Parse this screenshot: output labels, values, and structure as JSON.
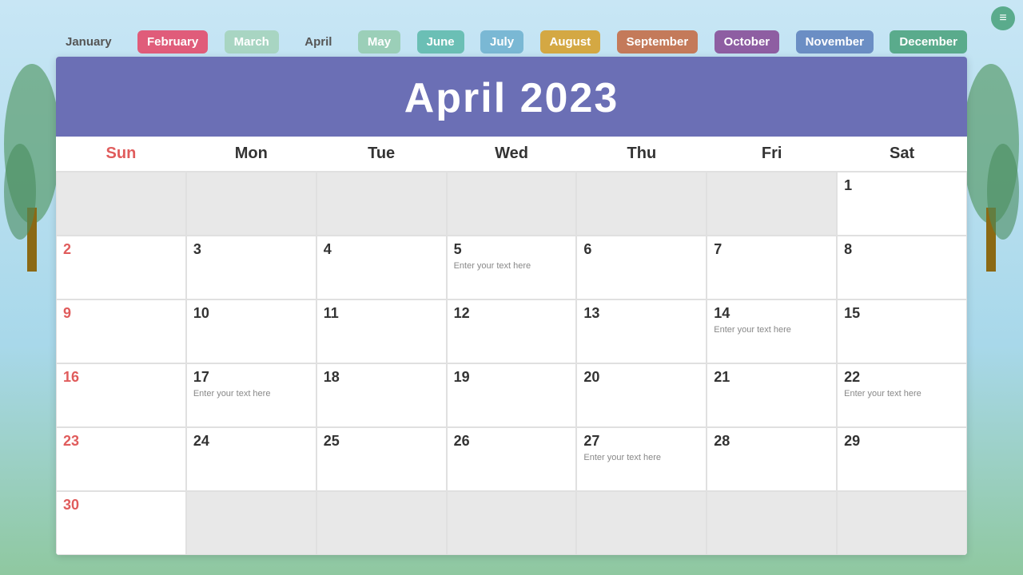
{
  "tabs": [
    {
      "id": "january",
      "label": "January",
      "active": false
    },
    {
      "id": "february",
      "label": "February",
      "active": true
    },
    {
      "id": "march",
      "label": "March",
      "active": false
    },
    {
      "id": "april",
      "label": "April",
      "active": false
    },
    {
      "id": "may",
      "label": "May",
      "active": false
    },
    {
      "id": "june",
      "label": "June",
      "active": false
    },
    {
      "id": "july",
      "label": "July",
      "active": false
    },
    {
      "id": "august",
      "label": "August",
      "active": false
    },
    {
      "id": "september",
      "label": "September",
      "active": false
    },
    {
      "id": "october",
      "label": "October",
      "active": false
    },
    {
      "id": "november",
      "label": "November",
      "active": false
    },
    {
      "id": "december",
      "label": "December",
      "active": false
    }
  ],
  "calendar": {
    "title": "April 2023",
    "dayHeaders": [
      "Sun",
      "Mon",
      "Tue",
      "Wed",
      "Thu",
      "Fri",
      "Sat"
    ],
    "cells": [
      {
        "day": "",
        "empty": true,
        "text": ""
      },
      {
        "day": "",
        "empty": true,
        "text": ""
      },
      {
        "day": "",
        "empty": true,
        "text": ""
      },
      {
        "day": "",
        "empty": true,
        "text": ""
      },
      {
        "day": "",
        "empty": true,
        "text": ""
      },
      {
        "day": "",
        "empty": true,
        "text": ""
      },
      {
        "day": "1",
        "empty": false,
        "text": "",
        "isSunday": false
      },
      {
        "day": "2",
        "empty": false,
        "text": "",
        "isSunday": true
      },
      {
        "day": "3",
        "empty": false,
        "text": "",
        "isSunday": false
      },
      {
        "day": "4",
        "empty": false,
        "text": "",
        "isSunday": false
      },
      {
        "day": "5",
        "empty": false,
        "text": "Enter your text here",
        "isSunday": false
      },
      {
        "day": "6",
        "empty": false,
        "text": "",
        "isSunday": false
      },
      {
        "day": "7",
        "empty": false,
        "text": "",
        "isSunday": false
      },
      {
        "day": "8",
        "empty": false,
        "text": "",
        "isSunday": false
      },
      {
        "day": "9",
        "empty": false,
        "text": "",
        "isSunday": true
      },
      {
        "day": "10",
        "empty": false,
        "text": "",
        "isSunday": false
      },
      {
        "day": "11",
        "empty": false,
        "text": "",
        "isSunday": false
      },
      {
        "day": "12",
        "empty": false,
        "text": "",
        "isSunday": false
      },
      {
        "day": "13",
        "empty": false,
        "text": "",
        "isSunday": false
      },
      {
        "day": "14",
        "empty": false,
        "text": "Enter your text here",
        "isSunday": false
      },
      {
        "day": "15",
        "empty": false,
        "text": "",
        "isSunday": false
      },
      {
        "day": "16",
        "empty": false,
        "text": "",
        "isSunday": true
      },
      {
        "day": "17",
        "empty": false,
        "text": "Enter your text here",
        "isSunday": false
      },
      {
        "day": "18",
        "empty": false,
        "text": "",
        "isSunday": false
      },
      {
        "day": "19",
        "empty": false,
        "text": "",
        "isSunday": false
      },
      {
        "day": "20",
        "empty": false,
        "text": "",
        "isSunday": false
      },
      {
        "day": "21",
        "empty": false,
        "text": "",
        "isSunday": false
      },
      {
        "day": "22",
        "empty": false,
        "text": "Enter your text here",
        "isSunday": false
      },
      {
        "day": "23",
        "empty": false,
        "text": "",
        "isSunday": true
      },
      {
        "day": "24",
        "empty": false,
        "text": "",
        "isSunday": false
      },
      {
        "day": "25",
        "empty": false,
        "text": "",
        "isSunday": false
      },
      {
        "day": "26",
        "empty": false,
        "text": "",
        "isSunday": false
      },
      {
        "day": "27",
        "empty": false,
        "text": "Enter your text here",
        "isSunday": false
      },
      {
        "day": "28",
        "empty": false,
        "text": "",
        "isSunday": false
      },
      {
        "day": "29",
        "empty": false,
        "text": "",
        "isSunday": false
      },
      {
        "day": "30",
        "empty": false,
        "text": "",
        "isSunday": true
      },
      {
        "day": "",
        "empty": true,
        "lastRow": true,
        "text": ""
      },
      {
        "day": "",
        "empty": true,
        "lastRow": true,
        "text": ""
      },
      {
        "day": "",
        "empty": true,
        "lastRow": true,
        "text": ""
      },
      {
        "day": "",
        "empty": true,
        "lastRow": true,
        "text": ""
      },
      {
        "day": "",
        "empty": true,
        "lastRow": true,
        "text": ""
      },
      {
        "day": "",
        "empty": true,
        "lastRow": true,
        "text": ""
      }
    ]
  },
  "nav_icon": "≡"
}
